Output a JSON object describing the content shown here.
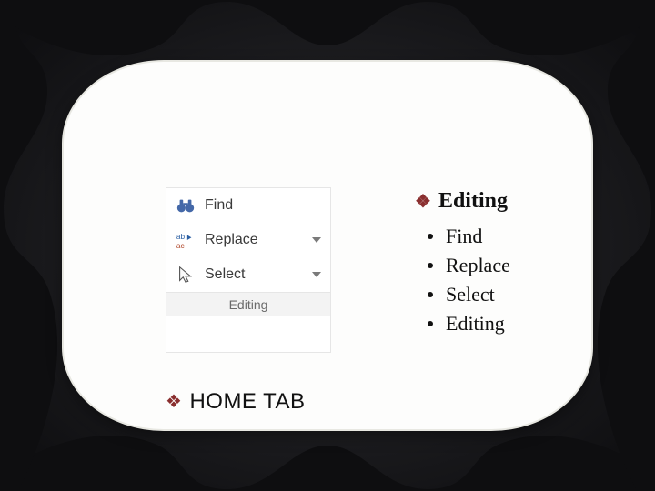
{
  "ribbon": {
    "find": {
      "label": "Find"
    },
    "replace": {
      "label": "Replace"
    },
    "select": {
      "label": "Select"
    },
    "group_label": "Editing"
  },
  "right_panel": {
    "heading": "Editing",
    "items": [
      "Find",
      "Replace",
      "Select",
      "Editing"
    ]
  },
  "footer_label": "HOME TAB",
  "icons": {
    "find": "binoculars-icon",
    "replace": "replace-ab-ac-icon",
    "select": "cursor-arrow-icon"
  }
}
